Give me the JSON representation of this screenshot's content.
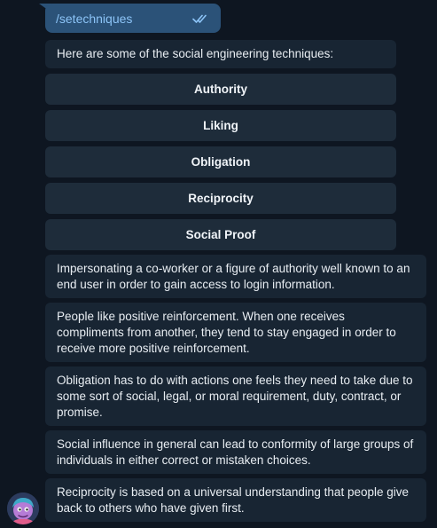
{
  "sent_message": {
    "text": "/setechniques",
    "status_icon": "double-check-icon"
  },
  "intro": {
    "text": "Here are some of the social engineering techniques:"
  },
  "keyboard_buttons": [
    {
      "label": "Authority"
    },
    {
      "label": "Liking"
    },
    {
      "label": "Obligation"
    },
    {
      "label": "Reciprocity"
    },
    {
      "label": "Social Proof"
    }
  ],
  "descriptions": [
    {
      "text": "Impersonating a co-worker or a figure of authority well known to an end user in order to gain access to login information."
    },
    {
      "text": "People like positive reinforcement. When one receives compliments from another, they tend to stay engaged in order to receive more positive reinforcement."
    },
    {
      "text": "Obligation has to do with actions one feels they need to take due to some sort of social, legal, or moral requirement, duty, contract, or promise."
    },
    {
      "text": "Social influence in general can lead to conformity of large groups of individuals in either correct or mistaken choices."
    },
    {
      "text": "Reciprocity is based on a universal understanding that people give back to others who have given first."
    }
  ],
  "colors": {
    "background": "#0e1621",
    "sent_bubble": "#2b5278",
    "received_bubble": "#182533",
    "keyboard_button": "#1e2c3a",
    "link": "#8cc4f7"
  }
}
